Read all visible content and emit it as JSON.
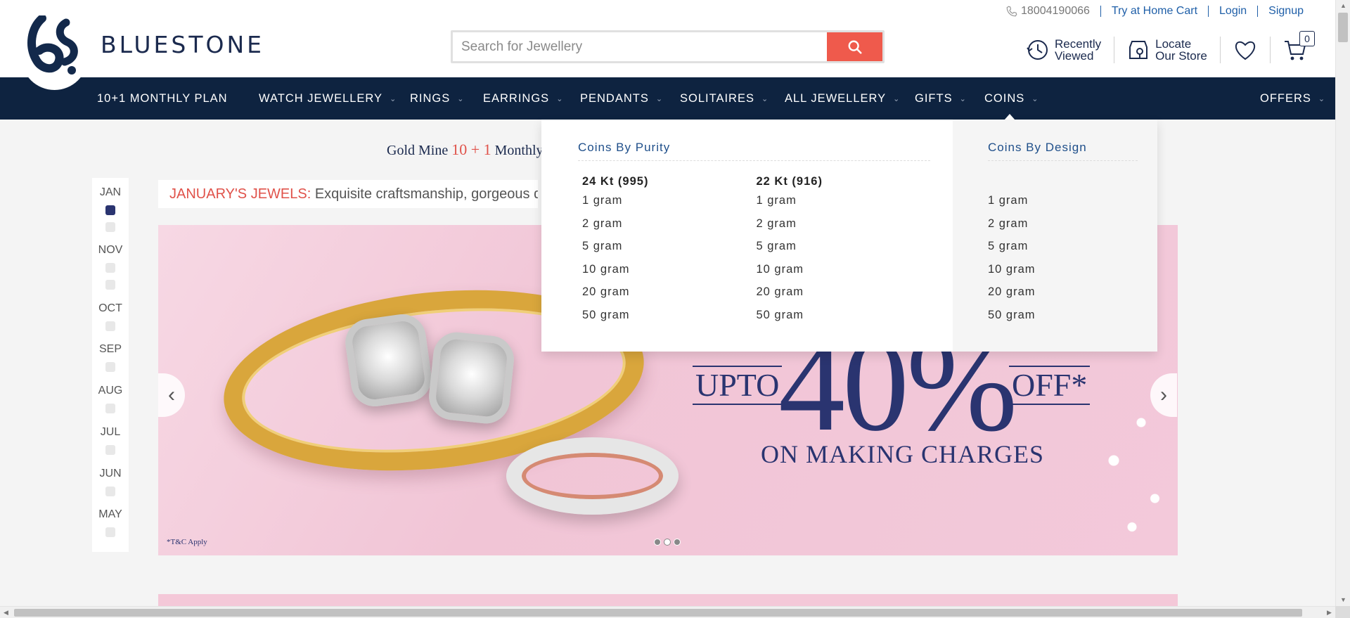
{
  "brand": {
    "name": "BLUESTONE"
  },
  "top_links": {
    "phone": "18004190066",
    "try_at_home": "Try at Home Cart",
    "login": "Login",
    "signup": "Signup"
  },
  "search": {
    "placeholder": "Search for Jewellery"
  },
  "header_actions": {
    "recently_viewed_line1": "Recently",
    "recently_viewed_line2": "Viewed",
    "locate_line1": "Locate",
    "locate_line2": "Our Store",
    "cart_count": "0"
  },
  "nav": {
    "items": [
      {
        "label": "10+1 MONTHLY PLAN",
        "has_dropdown": false
      },
      {
        "label": "WATCH JEWELLERY",
        "has_dropdown": true
      },
      {
        "label": "RINGS",
        "has_dropdown": true
      },
      {
        "label": "EARRINGS",
        "has_dropdown": true
      },
      {
        "label": "PENDANTS",
        "has_dropdown": true
      },
      {
        "label": "SOLITAIRES",
        "has_dropdown": true
      },
      {
        "label": "ALL JEWELLERY",
        "has_dropdown": true
      },
      {
        "label": "GIFTS",
        "has_dropdown": true
      },
      {
        "label": "COINS",
        "has_dropdown": true,
        "active": true
      },
      {
        "label": "OFFERS",
        "has_dropdown": true
      }
    ]
  },
  "coins_menu": {
    "purity_heading": "Coins By Purity",
    "design_heading": "Coins By Design",
    "col1_title": "24 Kt (995)",
    "col2_title": "22 Kt (916)",
    "col1_links": [
      "1 gram",
      "2 gram",
      "5 gram",
      "10 gram",
      "20 gram",
      "50 gram"
    ],
    "col2_links": [
      "1 gram",
      "2 gram",
      "5 gram",
      "10 gram",
      "20 gram",
      "50 gram"
    ],
    "design_links": [
      "1 gram",
      "2 gram",
      "5 gram",
      "10 gram",
      "20 gram",
      "50 gram"
    ]
  },
  "promo": {
    "prefix": "Gold Mine ",
    "highlight": "10 + 1",
    "suffix": " Monthly"
  },
  "month_nav": {
    "labels": [
      "JAN",
      "NOV",
      "OCT",
      "SEP",
      "AUG",
      "JUL",
      "JUN",
      "MAY"
    ],
    "active": "JAN"
  },
  "jewels_bar": {
    "title": "JANUARY'S JEWELS:",
    "text": " Exquisite craftsmanship, gorgeous de"
  },
  "banner": {
    "upto": "UPTO",
    "percent": "40%",
    "off": "OFF*",
    "subtitle": "ON MAKING CHARGES",
    "tnc": "*T&C Apply",
    "slide_count": 3,
    "active_slide": 2
  },
  "colors": {
    "navy": "#0e2340",
    "accent_red": "#ef5a4c",
    "link_blue": "#1f5fa8",
    "banner_pink": "#f3c9da"
  }
}
